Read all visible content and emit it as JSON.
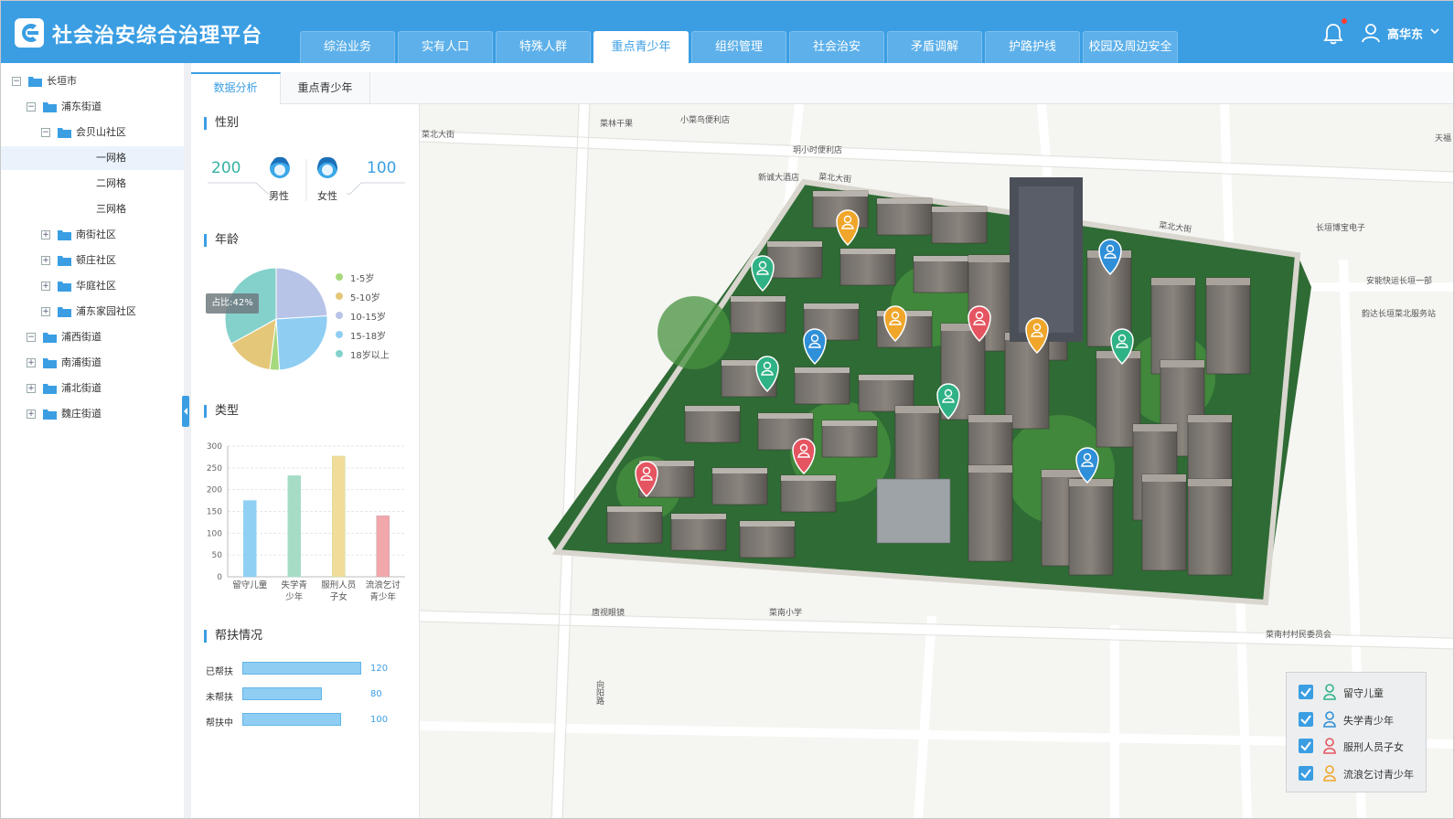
{
  "header": {
    "title": "社会治安综合治理平台",
    "nav": [
      "综治业务",
      "实有人口",
      "特殊人群",
      "重点青少年",
      "组织管理",
      "社会治安",
      "矛盾调解",
      "护路护线",
      "校园及周边安全"
    ],
    "active_nav": "重点青少年",
    "user_name": "高华东",
    "brand_color": "#3b9ee3",
    "has_notification": true
  },
  "tree": [
    {
      "label": "长垣市",
      "level": 0,
      "toggle": "−",
      "folder": true
    },
    {
      "label": "浦东街道",
      "level": 1,
      "toggle": "−",
      "folder": true
    },
    {
      "label": "会贝山社区",
      "level": 2,
      "toggle": "−",
      "folder": true
    },
    {
      "label": "一网格",
      "level": 3,
      "toggle": "",
      "folder": false,
      "selected": true
    },
    {
      "label": "二网格",
      "level": 3,
      "toggle": "",
      "folder": false
    },
    {
      "label": "三网格",
      "level": 3,
      "toggle": "",
      "folder": false
    },
    {
      "label": "南街社区",
      "level": 2,
      "toggle": "+",
      "folder": true
    },
    {
      "label": "顿庄社区",
      "level": 2,
      "toggle": "+",
      "folder": true
    },
    {
      "label": "华庭社区",
      "level": 2,
      "toggle": "+",
      "folder": true
    },
    {
      "label": "浦东家园社区",
      "level": 2,
      "toggle": "+",
      "folder": true
    },
    {
      "label": "浦西街道",
      "level": 1,
      "toggle": "−",
      "folder": true
    },
    {
      "label": "南浦街道",
      "level": 1,
      "toggle": "+",
      "folder": true
    },
    {
      "label": "浦北街道",
      "level": 1,
      "toggle": "+",
      "folder": true
    },
    {
      "label": "魏庄街道",
      "level": 1,
      "toggle": "+",
      "folder": true
    }
  ],
  "tabs": [
    "数据分析",
    "重点青少年"
  ],
  "active_tab": "数据分析",
  "gender": {
    "title": "性别",
    "male_count": "200",
    "male_label": "男性",
    "female_count": "100",
    "female_label": "女性",
    "male_color": "#35b2a3",
    "female_color": "#3b9ee3"
  },
  "age": {
    "title": "年龄",
    "tooltip": "占比:42%",
    "legend": [
      "1-5岁",
      "5-10岁",
      "10-15岁",
      "15-18岁",
      "18岁以上"
    ],
    "colors": [
      "#a6d97c",
      "#e5c779",
      "#b7c4e8",
      "#8fcdf3",
      "#84d1cc"
    ]
  },
  "category": {
    "title": "类型"
  },
  "help": {
    "title": "帮扶情况",
    "rows": [
      {
        "label": "已帮扶",
        "value": "120"
      },
      {
        "label": "未帮扶",
        "value": "80"
      },
      {
        "label": "帮扶中",
        "value": "100"
      }
    ],
    "bar_color": "#8fcdf3"
  },
  "chart_data": [
    {
      "type": "pie",
      "categories": [
        "1-5岁",
        "5-10岁",
        "10-15岁",
        "15-18岁",
        "18岁以上"
      ],
      "values": [
        3,
        15,
        24,
        25,
        33
      ]
    },
    {
      "type": "bar",
      "categories": [
        "留守儿童",
        "失学青少年",
        "服刑人员子女",
        "流浪乞讨青少年"
      ],
      "values": [
        175,
        232,
        277,
        140
      ],
      "ylim": [
        0,
        300
      ],
      "yticks": [
        0,
        50,
        100,
        150,
        200,
        250,
        300
      ],
      "colors": [
        "#8fd0f3",
        "#a6dcc6",
        "#f2dc9a",
        "#f2a7ab"
      ],
      "grid": true
    }
  ],
  "map": {
    "labels": [
      {
        "text": "菜北大街"
      },
      {
        "text": "菜林干果"
      },
      {
        "text": "小菜鸟便利店"
      },
      {
        "text": "玥小时便利店"
      },
      {
        "text": "新诚大酒店"
      },
      {
        "text": "菜北大街"
      },
      {
        "text": "菜北大街"
      },
      {
        "text": "长垣博宝电子"
      },
      {
        "text": "安能快运长垣一部"
      },
      {
        "text": "韵达长垣菜北服务站"
      },
      {
        "text": "唐视眼镜"
      },
      {
        "text": "菜南小学"
      },
      {
        "text": "向阳路"
      },
      {
        "text": "菜南村村民委员会"
      },
      {
        "text": "天福"
      }
    ],
    "marker_colors": {
      "green": "#2fb286",
      "blue": "#2f8fd8",
      "red": "#e55561",
      "orange": "#f0a62a"
    },
    "legend": [
      "留守儿童",
      "失学青少年",
      "服刑人员子女",
      "流浪乞讨青少年"
    ]
  }
}
